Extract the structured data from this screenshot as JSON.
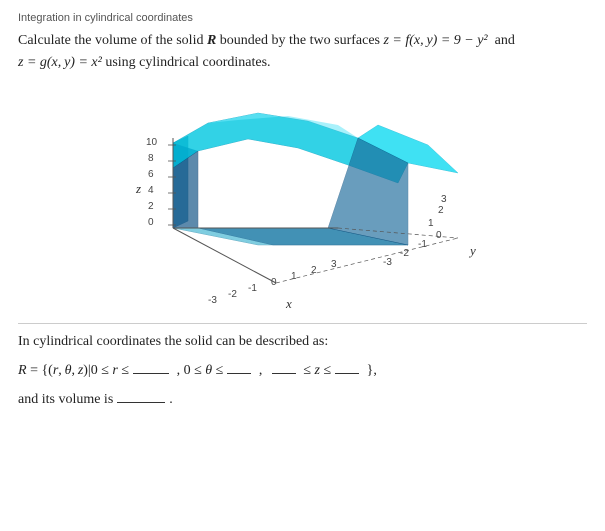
{
  "page": {
    "label": "Integration in cylindrical coordinates",
    "problem": {
      "intro": "Calculate the volume of the solid",
      "R_label": "R",
      "bounded_by": "bounded by the two surfaces",
      "z_equals": "z =",
      "f_label": "f(x, y) = 9 − y²",
      "and_text": "and",
      "g_eq": "z = g(x, y) = x²",
      "using": "using cylindrical coordinates."
    },
    "graph": {
      "z_axis_label": "z",
      "x_axis_label": "x",
      "y_axis_label": "y",
      "z_ticks": [
        "10",
        "8",
        "6",
        "4",
        "2",
        "0"
      ],
      "x_ticks": [
        "-3",
        "-2",
        "-1",
        "0",
        "1",
        "2",
        "3"
      ],
      "y_ticks": [
        "-3",
        "-2",
        "-1",
        "0",
        "1",
        "2",
        "3"
      ]
    },
    "description": {
      "text": "In cylindrical coordinates the solid can be described as:",
      "R_set": "R = {(r, θ, z)|0 ≤ r ≤",
      "theta_part": ", 0 ≤ θ ≤",
      "comma": ",",
      "z_part": "≤ z ≤",
      "closing": "},"
    },
    "volume": {
      "text": "and its volume is",
      "period": "."
    }
  }
}
